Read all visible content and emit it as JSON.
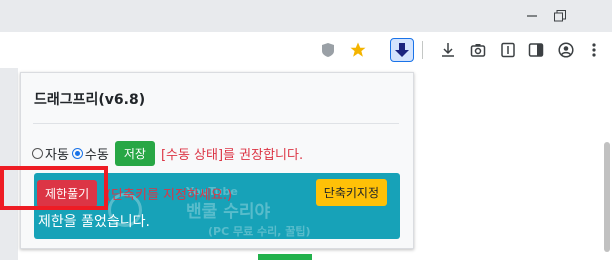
{
  "popup": {
    "title": "드래그프리(v6.8)",
    "mode_auto_label": "자동",
    "mode_manual_label": "수동",
    "save_label": "저장",
    "recommend_note": "[수동 상태]를 권장합니다.",
    "release_label": "제한풀기",
    "shortcut_hint": "(단축키를 지정하세요.)",
    "shortcut_button_label": "단축키지정",
    "result_message": "제한을 풀었습니다."
  },
  "watermark": {
    "youtube": "YouTube",
    "name": "밴쿨 수리야",
    "sub": "(PC 무료 수리, 꿀팁)"
  },
  "colors": {
    "save": "#28a745",
    "release": "#dc3545",
    "info": "#17a2b8",
    "shortcut": "#ffc107",
    "highlight": "#ee1c24"
  },
  "icons": [
    "minimize-icon",
    "restore-icon",
    "extension-shield-icon",
    "bookmark-star-icon",
    "dragfree-download-icon",
    "download-icon",
    "camera-icon",
    "reader-icon",
    "sidebar-icon",
    "profile-icon",
    "more-icon"
  ]
}
